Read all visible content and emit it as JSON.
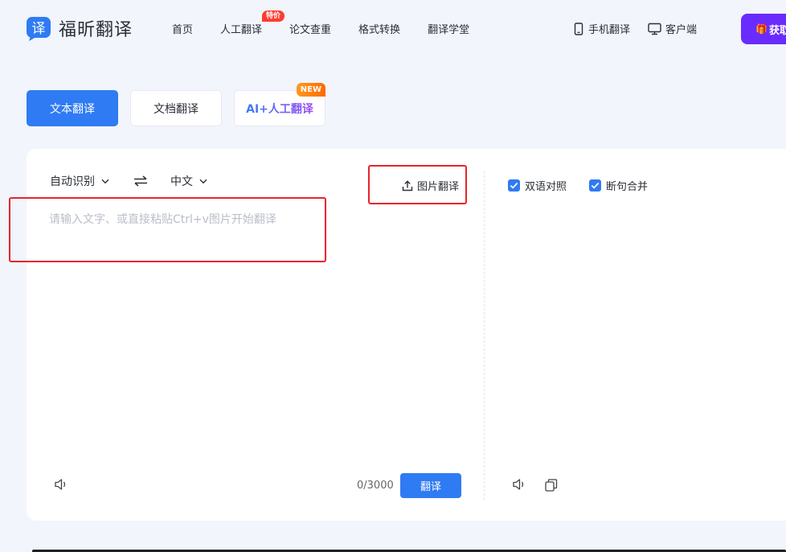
{
  "brand": {
    "logo_mark_text": "译",
    "name": "福昕翻译",
    "color": "#2f7bf3"
  },
  "nav": {
    "items": [
      {
        "label": "首页"
      },
      {
        "label": "人工翻译",
        "badge": "特价"
      },
      {
        "label": "论文查重"
      },
      {
        "label": "格式转换"
      },
      {
        "label": "翻译学堂"
      }
    ]
  },
  "header_right": {
    "mobile_label": "手机翻译",
    "mobile_icon": "phone-icon",
    "client_label": "客户端",
    "client_icon": "monitor-icon",
    "vip_label": "获取",
    "vip_icon": "gift-icon",
    "vip_color": "#6a2bff"
  },
  "tabs": [
    {
      "label": "文本翻译",
      "active": true
    },
    {
      "label": "文档翻译",
      "active": false
    },
    {
      "label": "AI+人工翻译",
      "active": false,
      "badge": "NEW"
    }
  ],
  "source": {
    "from_lang": "自动识别",
    "to_lang": "中文",
    "image_translate_label": "图片翻译",
    "placeholder": "请输入文字、或直接粘贴Ctrl+v图片开始翻译",
    "value": "",
    "counter": "0/3000",
    "translate_button": "翻译"
  },
  "target": {
    "option_bilingual": "双语对照",
    "option_bilingual_checked": true,
    "option_merge": "断句合并",
    "option_merge_checked": true
  },
  "colors": {
    "accent": "#2f7bf3",
    "annotation": "#e8242b",
    "badge_red": "#ff3b30",
    "badge_orange": "#ff7a00"
  }
}
